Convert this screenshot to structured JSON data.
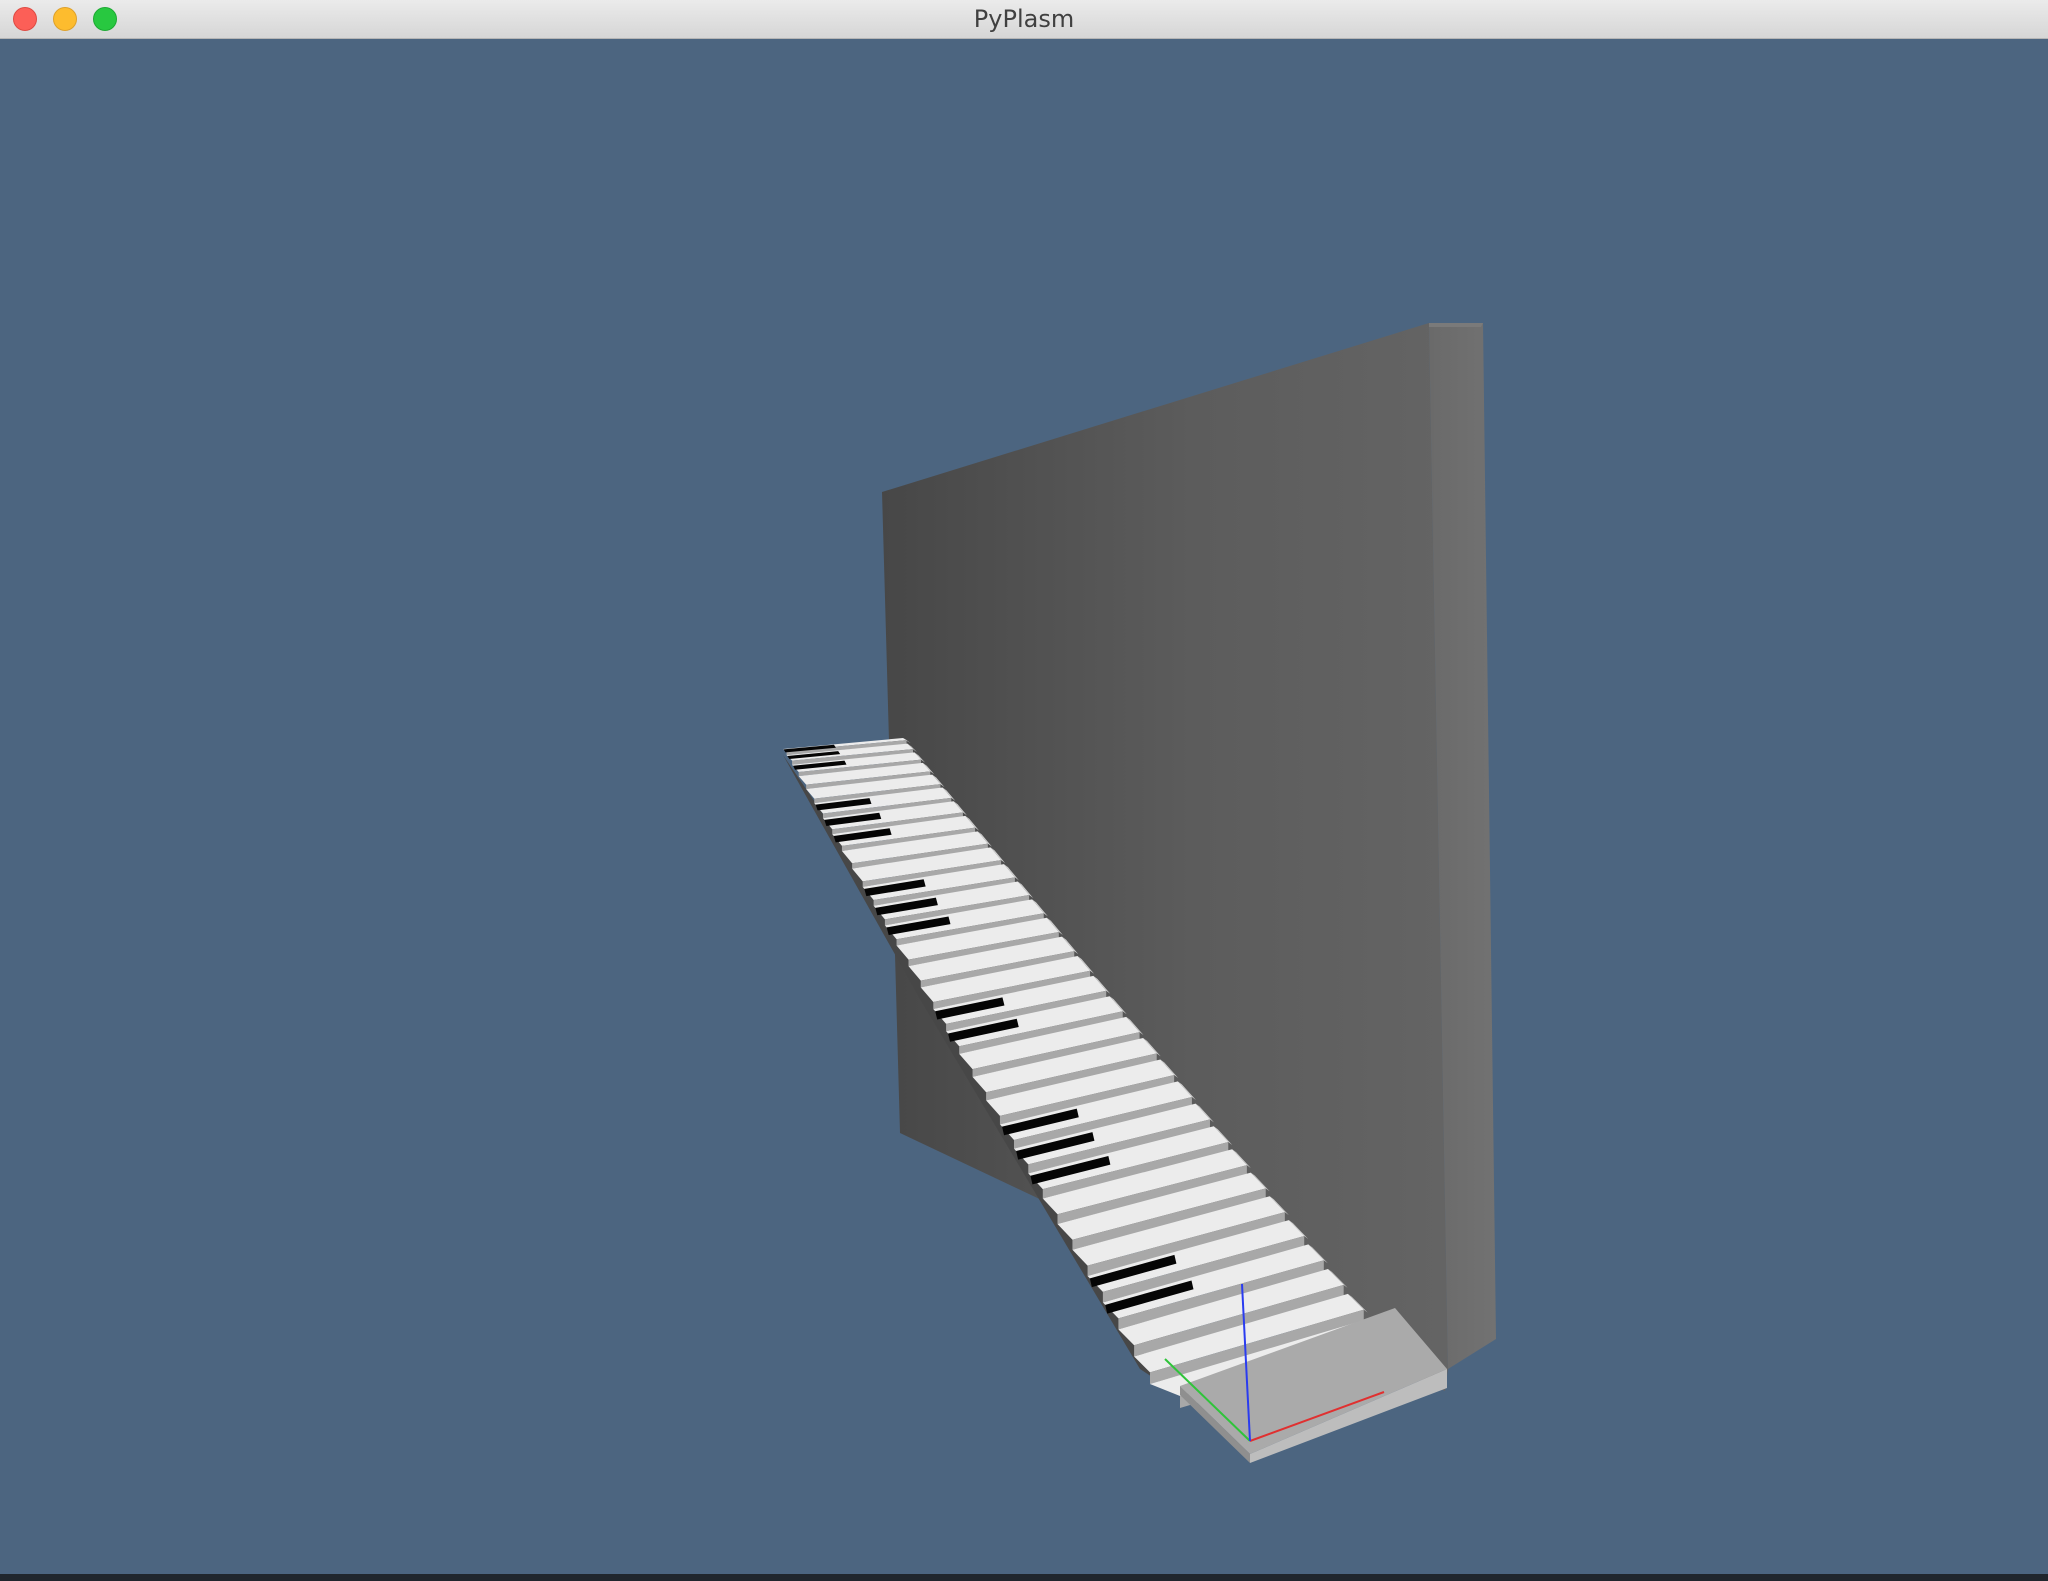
{
  "window": {
    "title": "PyPlasm",
    "background_color": "#4c6580",
    "controls": {
      "close": {
        "color": "#fc5f57",
        "icon": "close-icon"
      },
      "minimize": {
        "color": "#fdbc2e",
        "icon": "minimize-icon"
      },
      "maximize": {
        "color": "#28c840",
        "icon": "maximize-icon"
      }
    }
  },
  "scene": {
    "objects": [
      "piano-lid-panel",
      "piano-keyboard",
      "base-plate",
      "axis-gizmo"
    ],
    "axes": {
      "x_color": "#e03030",
      "y_color": "#2fc43a",
      "z_color": "#2a3cf0"
    },
    "key_count": 32,
    "black_key_steps": [
      0,
      1,
      2,
      5,
      6,
      7,
      10,
      11,
      12,
      16,
      17,
      21,
      22,
      23,
      27,
      28
    ]
  }
}
